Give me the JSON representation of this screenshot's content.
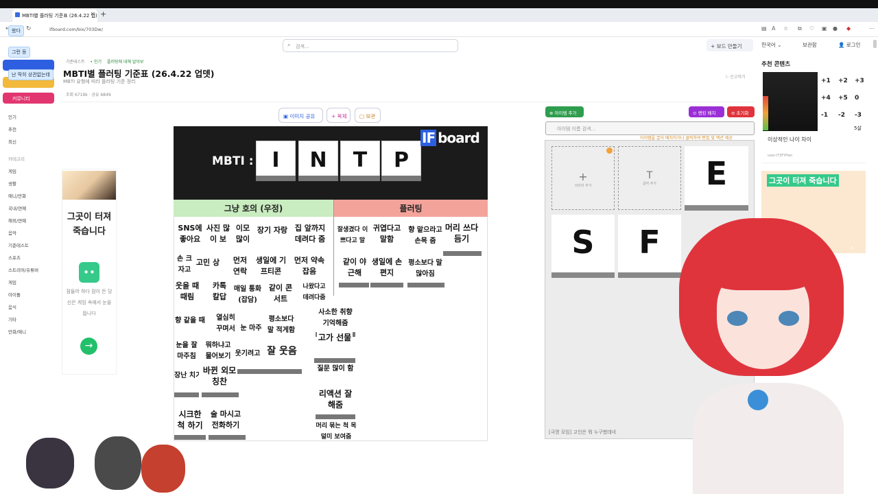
{
  "browser": {
    "tab_title": "MBTI별 플러팅 기준표 (26.4.22 업)",
    "new_tab": "+",
    "url": "ifboard.com/bix/703Dw/"
  },
  "chat_overlay": [
    "왔다",
    "그런 등",
    "난 딱히 상관없는데"
  ],
  "header": {
    "search_placeholder": "검색...",
    "make_board": "+ 보드 만들기",
    "language": "한국어",
    "storage": "보관함",
    "login": "로그인"
  },
  "sidebar": {
    "community": "커뮤니티",
    "items": [
      "인기",
      "추천",
      "최신",
      "카테고리",
      "게임",
      "생활",
      "애니/만화",
      "국내/연예",
      "해외/연예",
      "음악",
      "기준테스트",
      "스포츠",
      "스트리머/유튜버",
      "게임",
      "아이돌",
      "음식",
      "기타",
      "만화/애니"
    ]
  },
  "page": {
    "crumb": "기준테스트",
    "crumb_pill": "• 인기",
    "crumb_pill2": "플러팅에 대해 알아보",
    "title": "MBTI별 플러팅 기준표 (26.4.22 업뎃)",
    "subtitle": "MBTI 유형에 따라 플러팅 기준 정리",
    "meta": "조회 6719k · 공유 6849",
    "actions": [
      "이미지 공유",
      "+ 복제",
      "보관"
    ]
  },
  "ad_left": {
    "title": "그곳이 터져 죽습니다",
    "text": "잠들어 하다 잠이 든 당신은 게임 속에서 눈을 뜹니다",
    "go": "→"
  },
  "board": {
    "mbti_label": "MBTI :",
    "letters": [
      "I",
      "N",
      "T",
      "P"
    ],
    "brand_if": "IF",
    "brand_rest": "board",
    "col_friend": "그냥 호의 (우정)",
    "col_flirt": "플러팅",
    "cards": [
      "SNS에 좋아요",
      "사진 많이 보",
      "이모 많이",
      "장기 자랑",
      "집 앞까지 데려다 줌",
      "잘생겼다 이쁘다고 말",
      "귀엽다고 말함",
      "향 맡으라고 손목 줌",
      "머리 쓰다듬기",
      "손 크 자고 손",
      "고민 상",
      "먼저 연락",
      "생일에 기프티콘",
      "먼저 약속 잡음",
      "같이 야근해",
      "생일에 손편지",
      "평소보다 말 많아짐",
      "웃을 때 때림",
      "카톡 칼답",
      "매일 통화 (잡담)",
      "같이 콘서트",
      "나왔다고 데려다줌",
      "향 같을 때",
      "열심히 꾸며서",
      "눈 마주",
      "평소보다 말 적게함",
      "사소한 취향 기억해줌",
      "눈을 잘 마주침",
      "뭐하냐고 물어보기",
      "웃기려고",
      "잘 웃음",
      "고가 선물",
      "장난 치기",
      "바뀐 외모 칭찬",
      "질문 많이 함",
      "리액션 잘해줌",
      "시크한 척 하기",
      "술 마시고 전화하기",
      "머리 묶는 척 목덜미 보여줌"
    ]
  },
  "item_panel": {
    "add_item": "아이템 추가",
    "reset_tier": "랭킹 배치",
    "reset": "초기화",
    "search_placeholder": "아이템 이름 검색...",
    "hint": "아이템을 끌어 배치하거나 클릭하여 편집 및 액션 제공",
    "slot_add": "이미지 추가",
    "slot_text": "글자 추가",
    "tiles": [
      "E",
      "S",
      "F"
    ],
    "footer": "[극명 모임] 고인은 뭐 누구했데네"
  },
  "recommend": {
    "title": "추천 콘텐츠",
    "nums": [
      "+1",
      "+2",
      "+3",
      "+4",
      "+5",
      "0",
      "-1",
      "-2",
      "-3"
    ],
    "five": "5살",
    "item_title": "이상적인 나이 차이",
    "item_sub": "user-I73FYPwn",
    "ad_title": "그곳이 터져 죽습니다"
  },
  "colors": {
    "accent_green": "#22c06a",
    "accent_pink": "#e23670",
    "column_friend": "#c9ecc0",
    "column_flirt": "#f4a39b"
  }
}
